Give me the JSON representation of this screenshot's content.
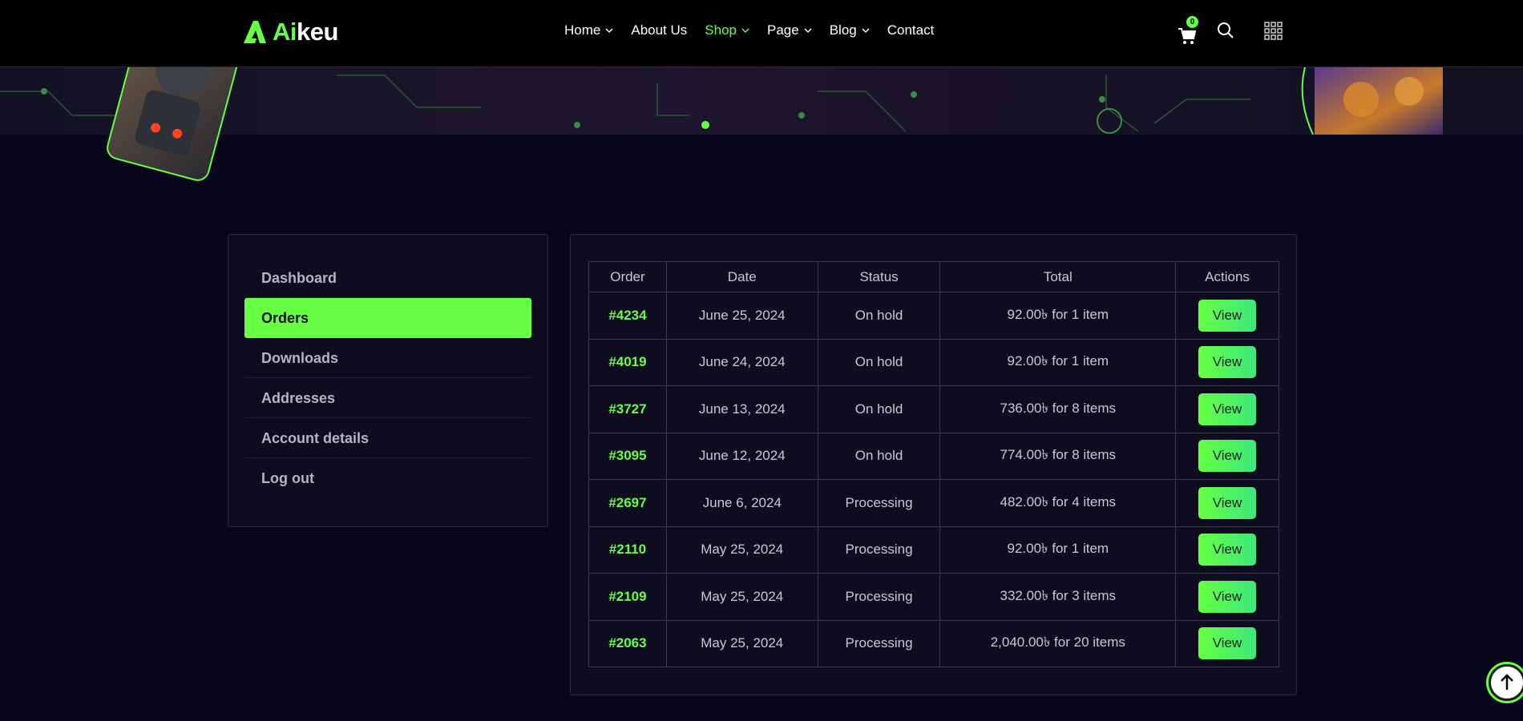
{
  "brand": {
    "prefix": "Ai",
    "suffix": "keu",
    "accent": "#66ff44"
  },
  "nav": [
    {
      "label": "Home",
      "dropdown": true,
      "active": false
    },
    {
      "label": "About Us",
      "dropdown": false,
      "active": false
    },
    {
      "label": "Shop",
      "dropdown": true,
      "active": true
    },
    {
      "label": "Page",
      "dropdown": true,
      "active": false
    },
    {
      "label": "Blog",
      "dropdown": true,
      "active": false
    },
    {
      "label": "Contact",
      "dropdown": false,
      "active": false
    }
  ],
  "header_icons": {
    "cart": "cart-icon",
    "cart_count": "0",
    "search": "search-icon",
    "menu": "grid-menu-icon"
  },
  "sidebar": {
    "items": [
      {
        "label": "Dashboard",
        "active": false
      },
      {
        "label": "Orders",
        "active": true
      },
      {
        "label": "Downloads",
        "active": false
      },
      {
        "label": "Addresses",
        "active": false
      },
      {
        "label": "Account details",
        "active": false
      },
      {
        "label": "Log out",
        "active": false
      }
    ]
  },
  "orders": {
    "headers": [
      "Order",
      "Date",
      "Status",
      "Total",
      "Actions"
    ],
    "rows": [
      {
        "order": "#4234",
        "date": "June 25, 2024",
        "status": "On hold",
        "total": "92.00৳  for 1 item",
        "action": "View"
      },
      {
        "order": "#4019",
        "date": "June 24, 2024",
        "status": "On hold",
        "total": "92.00৳  for 1 item",
        "action": "View"
      },
      {
        "order": "#3727",
        "date": "June 13, 2024",
        "status": "On hold",
        "total": "736.00৳  for 8 items",
        "action": "View"
      },
      {
        "order": "#3095",
        "date": "June 12, 2024",
        "status": "On hold",
        "total": "774.00৳  for 8 items",
        "action": "View"
      },
      {
        "order": "#2697",
        "date": "June 6, 2024",
        "status": "Processing",
        "total": "482.00৳  for 4 items",
        "action": "View"
      },
      {
        "order": "#2110",
        "date": "May 25, 2024",
        "status": "Processing",
        "total": "92.00৳  for 1 item",
        "action": "View"
      },
      {
        "order": "#2109",
        "date": "May 25, 2024",
        "status": "Processing",
        "total": "332.00৳  for 3 items",
        "action": "View"
      },
      {
        "order": "#2063",
        "date": "May 25, 2024",
        "status": "Processing",
        "total": "2,040.00৳  for 20 items",
        "action": "View"
      }
    ]
  },
  "scroll_top": "arrow-up-icon"
}
